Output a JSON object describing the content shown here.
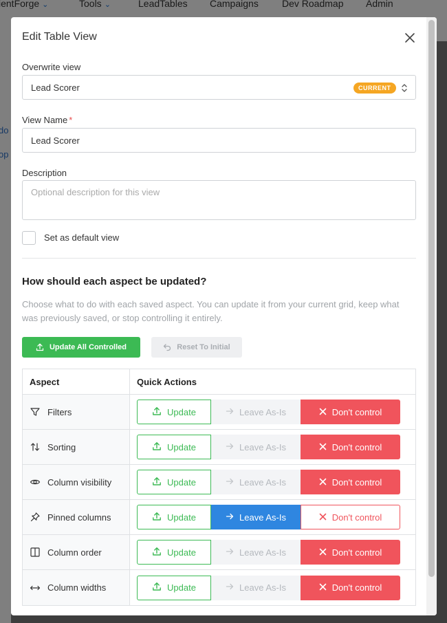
{
  "nav": {
    "items": [
      {
        "label": "ientForge",
        "dropdown": true
      },
      {
        "label": "Tools",
        "dropdown": true
      },
      {
        "label": "LeadTables",
        "dropdown": false
      },
      {
        "label": "Campaigns",
        "dropdown": false
      },
      {
        "label": "Dev Roadmap",
        "dropdown": false
      },
      {
        "label": "Admin",
        "dropdown": false
      }
    ]
  },
  "side_fragments": [
    "do",
    "op"
  ],
  "modal": {
    "title": "Edit Table View",
    "overwrite": {
      "label": "Overwrite view",
      "value": "Lead Scorer",
      "badge": "CURRENT"
    },
    "view_name": {
      "label": "View Name",
      "required_mark": "*",
      "value": "Lead Scorer"
    },
    "description": {
      "label": "Description",
      "placeholder": "Optional description for this view"
    },
    "default_checkbox": {
      "label": "Set as default view",
      "checked": false
    },
    "section": {
      "title": "How should each aspect be updated?",
      "description": "Choose what to do with each saved aspect. You can update it from your current grid, keep what was previously saved, or stop controlling it entirely."
    },
    "buttons": {
      "update_all": "Update All Controlled",
      "reset": "Reset To Initial"
    },
    "table": {
      "headers": {
        "aspect": "Aspect",
        "actions": "Quick Actions"
      },
      "action_labels": {
        "update": "Update",
        "leave": "Leave As-Is",
        "dont": "Don't control"
      },
      "rows": [
        {
          "aspect": "Filters",
          "icon": "filter-icon",
          "selected": "dont"
        },
        {
          "aspect": "Sorting",
          "icon": "sort-icon",
          "selected": "dont"
        },
        {
          "aspect": "Column visibility",
          "icon": "eye-icon",
          "selected": "dont"
        },
        {
          "aspect": "Pinned columns",
          "icon": "pin-icon",
          "selected": "leave"
        },
        {
          "aspect": "Column order",
          "icon": "columns-icon",
          "selected": "dont"
        },
        {
          "aspect": "Column widths",
          "icon": "resize-horizontal-icon",
          "selected": "dont"
        }
      ]
    }
  },
  "colors": {
    "accent_green": "#3cba54",
    "accent_blue": "#2f86e0",
    "accent_red": "#f0545c",
    "badge_orange": "#f5a623"
  }
}
